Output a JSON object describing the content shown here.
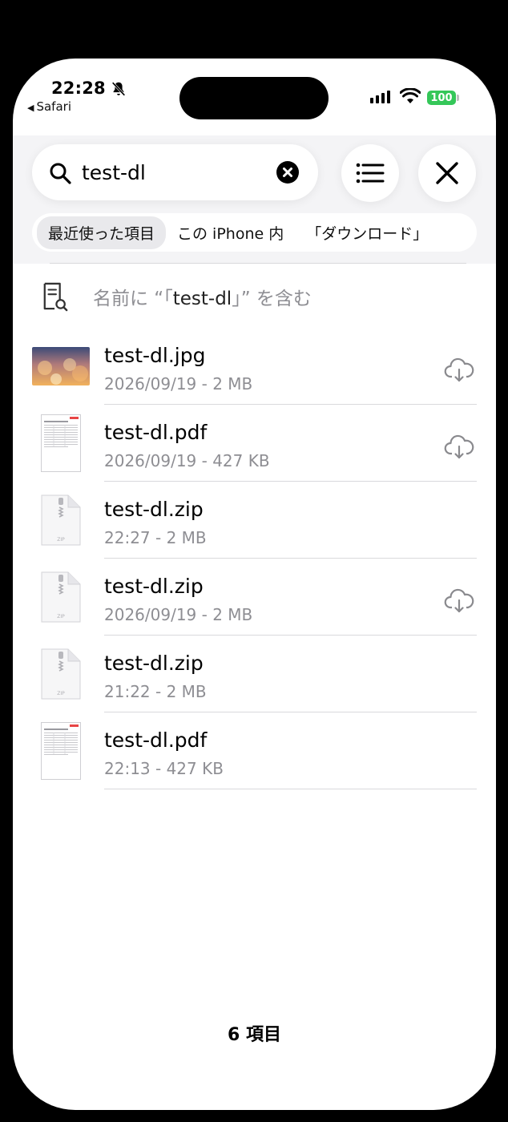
{
  "status_bar": {
    "time": "22:28",
    "back_app": "Safari",
    "battery": "100",
    "icons": [
      "bell-slash-icon",
      "signal-icon",
      "wifi-icon",
      "battery-icon"
    ]
  },
  "search": {
    "query": "test-dl",
    "icons": [
      "search-icon",
      "clear-icon",
      "list-view-icon",
      "close-icon"
    ]
  },
  "scope_tabs": [
    {
      "label": "最近使った項目",
      "selected": true
    },
    {
      "label": "この iPhone 内",
      "selected": false
    },
    {
      "label": "「ダウンロード」",
      "selected": false
    }
  ],
  "suggestion": {
    "prefix": "名前に “「",
    "query": "test-dl",
    "suffix": "」” を含む",
    "icon": "document-search-icon"
  },
  "results": [
    {
      "name": "test-dl.jpg",
      "meta": "2026/09/19 - 2 MB",
      "kind": "jpg",
      "cloud": true
    },
    {
      "name": "test-dl.pdf",
      "meta": "2026/09/19 - 427 KB",
      "kind": "pdf",
      "cloud": true
    },
    {
      "name": "test-dl.zip",
      "meta": "22:27 - 2 MB",
      "kind": "zip",
      "cloud": false
    },
    {
      "name": "test-dl.zip",
      "meta": "2026/09/19 - 2 MB",
      "kind": "zip",
      "cloud": true
    },
    {
      "name": "test-dl.zip",
      "meta": "21:22 - 2 MB",
      "kind": "zip",
      "cloud": false
    },
    {
      "name": "test-dl.pdf",
      "meta": "22:13 - 427 KB",
      "kind": "pdf",
      "cloud": false
    }
  ],
  "zip_label": "ZIP",
  "footer": {
    "count": "6 項目"
  },
  "colors": {
    "accent_green": "#35c759",
    "secondary_text": "#8e8e93"
  }
}
